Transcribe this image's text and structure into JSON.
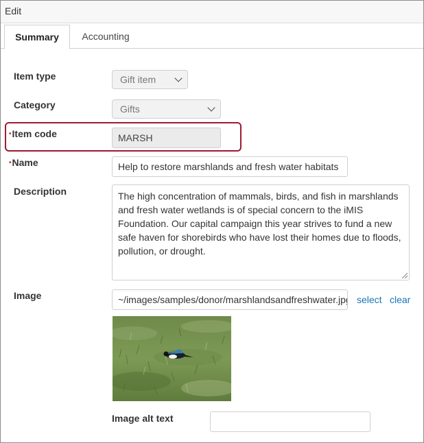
{
  "window": {
    "title": "Edit"
  },
  "tabs": [
    {
      "label": "Summary",
      "active": true
    },
    {
      "label": "Accounting",
      "active": false
    }
  ],
  "fields": {
    "item_type": {
      "label": "Item type",
      "value": "Gift item"
    },
    "category": {
      "label": "Category",
      "value": "Gifts"
    },
    "item_code": {
      "label": "Item code",
      "value": "MARSH",
      "required_marker": "•"
    },
    "name": {
      "label": "Name",
      "value": "Help to restore marshlands and fresh water habitats",
      "required_marker": "•"
    },
    "description": {
      "label": "Description",
      "value": "The high concentration of mammals, birds, and fish in marshlands and fresh water wetlands is of special concern to the iMIS Foundation. Our capital campaign this year strives to fund a new safe haven for shorebirds who have lost their homes due to floods, pollution, or drought."
    },
    "image": {
      "label": "Image",
      "value": "~/images/samples/donor/marshlandsandfreshwater.jpg",
      "select_link": "select",
      "clear_link": "clear"
    },
    "image_alt": {
      "label": "Image alt text",
      "value": ""
    }
  },
  "colors": {
    "highlight": "#9b1b30",
    "link": "#1a73b8",
    "required": "#c0392b"
  }
}
